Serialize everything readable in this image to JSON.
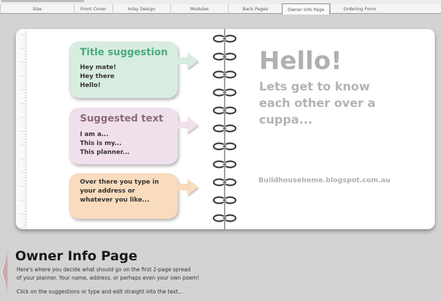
{
  "tabs": [
    {
      "label": "Size",
      "active": false
    },
    {
      "label": "Front Cover",
      "active": false
    },
    {
      "label": "Inlay Design",
      "active": false
    },
    {
      "label": "Modules",
      "active": false
    },
    {
      "label": "Back Pages",
      "active": false
    },
    {
      "label": "Owner Info Page",
      "active": true
    },
    {
      "label": "Ordering Form",
      "active": false
    }
  ],
  "suggestions": [
    {
      "title": "Title suggestion",
      "lines": [
        "Hey mate!",
        "Hey there",
        "Hello!"
      ],
      "fill": "#d8ece0",
      "title_color": "#4aaa7d",
      "text_color": "#333333",
      "arrow_color": "#d8ece0"
    },
    {
      "title": "Suggested text",
      "lines": [
        "I am a...",
        "This is my...",
        "This planner..."
      ],
      "fill": "#f0e0ec",
      "title_color": "#8a6a7c",
      "text_color": "#333333",
      "arrow_color": "#f0e0ec"
    },
    {
      "title": "",
      "lines": [
        "Over there you type in",
        "your address or",
        "whatever you like..."
      ],
      "fill": "#f9dbbd",
      "title_color": "#333333",
      "text_color": "#333333",
      "arrow_color": "#f9dbbd"
    }
  ],
  "right_page": {
    "greeting": "Hello!",
    "intro_text": "Lets get to know each other over a cuppa...",
    "blog_url": "Buildhousehome.blogspot.com.au"
  },
  "footer": {
    "title": "Owner Info Page",
    "description_lines": [
      "Here's where you decide what should go on the first 2-page spread",
      "of your planner. Your name, address, or perhaps even your own poem!"
    ],
    "hint": "Click on the suggestions or type and edit straight into the text..."
  },
  "colors": {
    "background": "#d3d3d3",
    "page": "#ffffff",
    "ring": "#3a3a3a",
    "muted_text": "#b0b0b0"
  },
  "icons": {
    "back": "left-triangle-arrow",
    "binding": "spiral-binding-ring"
  }
}
